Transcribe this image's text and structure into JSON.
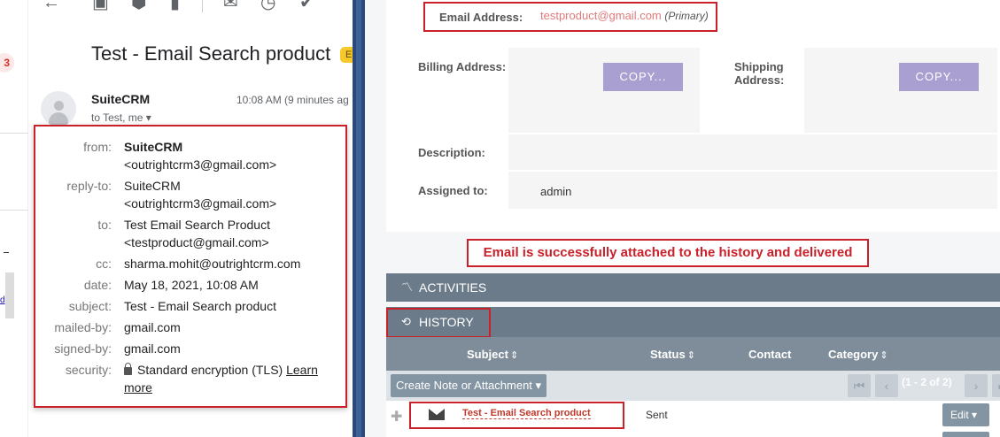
{
  "gmail": {
    "strip_badge": "3",
    "subject": "Test - Email Search product",
    "label_tag": "E",
    "sender_name": "SuiteCRM",
    "time": "10:08 AM (9 minutes ag",
    "to_line": "to Test, me ▾",
    "details": [
      {
        "key": "from:",
        "lines": [
          "SuiteCRM",
          "<outrightcrm3@gmail.com>"
        ]
      },
      {
        "key": "reply-to:",
        "lines": [
          "SuiteCRM",
          "<outrightcrm3@gmail.com>"
        ]
      },
      {
        "key": "to:",
        "lines": [
          "Test Email Search Product",
          "<testproduct@gmail.com>"
        ]
      },
      {
        "key": "cc:",
        "lines": [
          "sharma.mohit@outrightcrm.com"
        ]
      },
      {
        "key": "date:",
        "lines": [
          "May 18, 2021, 10:08 AM"
        ]
      },
      {
        "key": "subject:",
        "lines": [
          "Test - Email Search product"
        ]
      },
      {
        "key": "mailed-by:",
        "lines": [
          "gmail.com"
        ]
      },
      {
        "key": "signed-by:",
        "lines": [
          "gmail.com"
        ]
      },
      {
        "key": "security:",
        "lines": [
          "Standard encryption (TLS) ",
          "more"
        ],
        "link": "Learn"
      }
    ],
    "strip_link": "d"
  },
  "crm": {
    "email_label": "Email Address:",
    "email_value": "testproduct@gmail.com",
    "email_primary": "(Primary)",
    "billing_label": "Billing Address:",
    "shipping_label_1": "Shipping",
    "shipping_label_2": "Address:",
    "copy_label": "COPY...",
    "description_label": "Description:",
    "assigned_label": "Assigned to:",
    "assigned_value": "admin",
    "success_message": "Email is successfully attached to the history and delivered",
    "activities_title": "ACTIVITIES",
    "history_title": "HISTORY",
    "columns": [
      "Subject",
      "Status",
      "Contact",
      "Category"
    ],
    "create_button": "Create Note or Attachment",
    "pager_text": "(1 - 2 of 2)",
    "row": {
      "subject": "Test - Email Search product",
      "status": "Sent",
      "edit": "Edit"
    }
  }
}
